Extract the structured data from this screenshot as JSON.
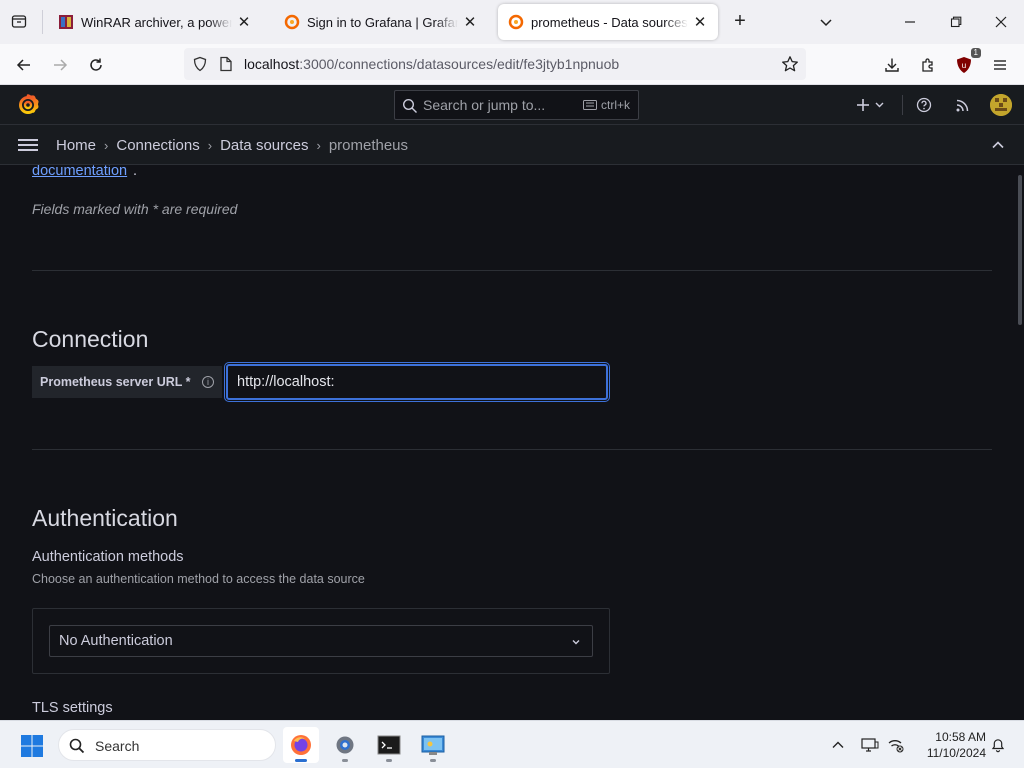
{
  "browser": {
    "tabs": [
      {
        "title": "WinRAR archiver, a powerful to",
        "favicon": "winrar-icon"
      },
      {
        "title": "Sign in to Grafana | Grafana doc",
        "favicon": "grafana-icon"
      },
      {
        "title": "prometheus - Data sources - Co",
        "favicon": "grafana-icon",
        "active": true
      }
    ],
    "url_host": "localhost",
    "url_rest": ":3000/connections/datasources/edit/fe3jtyb1npnuob",
    "ublock_count": "1"
  },
  "grafana": {
    "search_placeholder": "Search or jump to...",
    "search_shortcut": "ctrl+k",
    "breadcrumb": [
      "Home",
      "Connections",
      "Data sources",
      "prometheus"
    ],
    "doc_link": "documentation",
    "doc_link_suffix": ".",
    "required_note": "Fields marked with * are required",
    "connection": {
      "heading": "Connection",
      "url_label": "Prometheus server URL *",
      "url_value": "http://localhost:"
    },
    "authentication": {
      "heading": "Authentication",
      "methods_label": "Authentication methods",
      "methods_desc": "Choose an authentication method to access the data source",
      "selected": "No Authentication"
    },
    "tls_label": "TLS settings"
  },
  "taskbar": {
    "search_label": "Search",
    "time": "10:58 AM",
    "date": "11/10/2024"
  },
  "colors": {
    "accent": "#3d71d9",
    "link": "#6e9fff",
    "grafana_bg": "#111217",
    "grafana_panel": "#181b1f"
  }
}
